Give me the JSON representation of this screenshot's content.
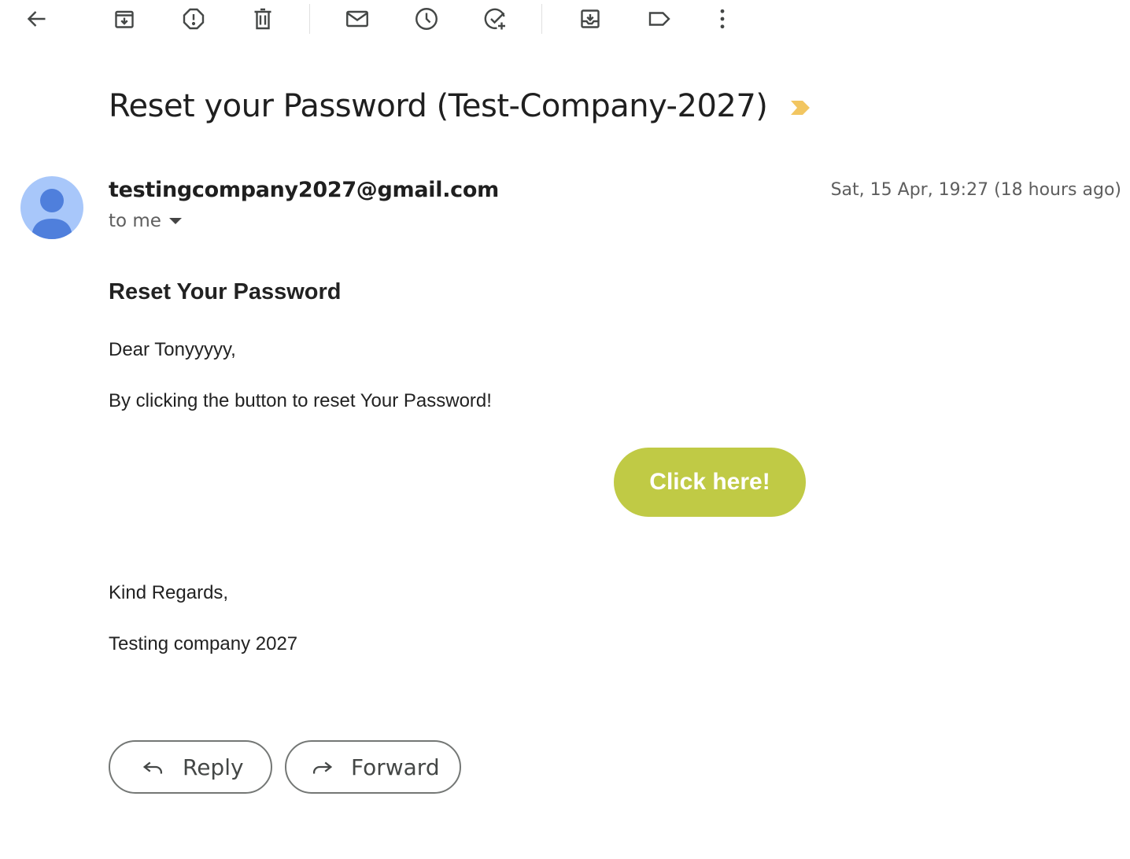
{
  "toolbar": {
    "icons": [
      "back-arrow-icon",
      "archive-icon",
      "report-spam-icon",
      "delete-icon",
      "mark-unread-icon",
      "snooze-icon",
      "add-task-icon",
      "move-to-icon",
      "label-icon",
      "more-options-icon"
    ]
  },
  "email": {
    "subject": "Reset your Password (Test-Company-2027)",
    "sender": "testingcompany2027@gmail.com",
    "recipient_label": "to me",
    "date": "Sat, 15 Apr, 19:27 (18 hours ago)"
  },
  "body": {
    "heading": "Reset Your Password",
    "greeting": "Dear Tonyyyyy,",
    "message": "By clicking the button to reset Your Password!",
    "cta_label": "Click here!",
    "closing": "Kind Regards,",
    "signature": "Testing company 2027"
  },
  "actions": {
    "reply_label": "Reply",
    "forward_label": "Forward"
  },
  "colors": {
    "cta_background": "#c0ca45",
    "importance_marker": "#f2c661",
    "avatar_background": "#a8c7fa",
    "avatar_figure": "#4f7fdc"
  }
}
